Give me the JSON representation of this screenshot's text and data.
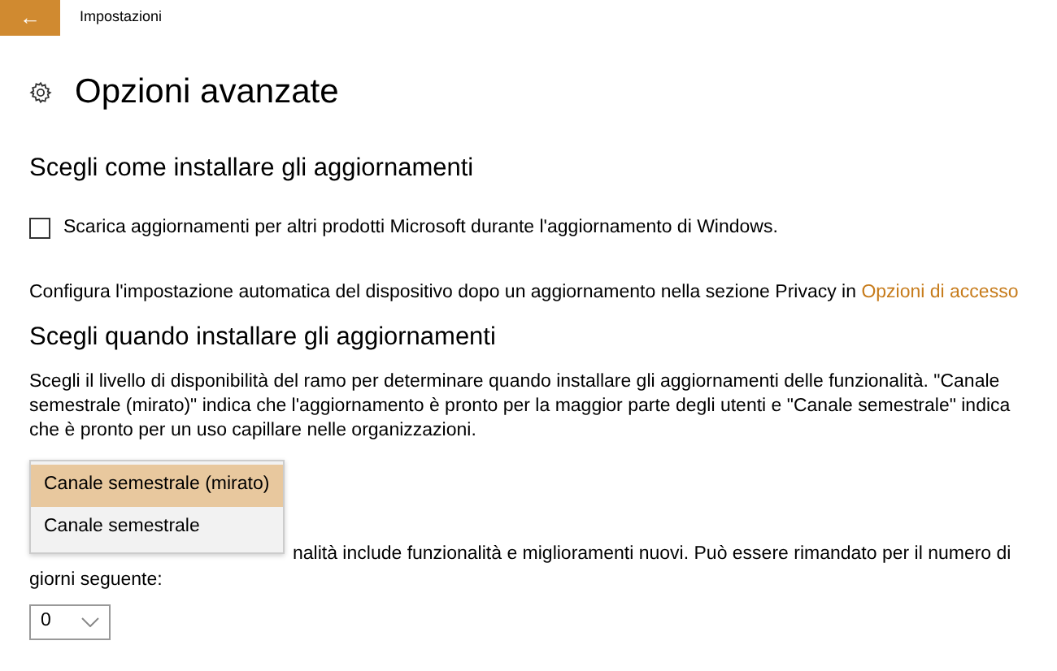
{
  "header": {
    "back_icon": "←",
    "title": "Impostazioni"
  },
  "page_title": "Opzioni avanzate",
  "sections": [
    {
      "heading": "Scegli come installare gli aggiornamenti",
      "checkbox": {
        "label": "Scarica aggiornamenti per altri prodotti Microsoft durante l'aggiornamento di Windows.",
        "checked": false
      },
      "note": "Configura l'impostazione automatica del dispositivo dopo un aggiornamento nella sezione Privacy in",
      "link": "Opzioni di accesso"
    },
    {
      "heading": "Scegli quando installare gli aggiornamenti",
      "description": "Scegli il livello di disponibilità del ramo per determinare quando installare gli aggiornamenti delle funzionalità. \"Canale semestrale (mirato)\" indica che l'aggiornamento è pronto per la maggior parte degli utenti e \"Canale semestrale\" indica che è pronto per un uso capillare nelle organizzazioni.",
      "dropdown": {
        "options": [
          {
            "label": "Canale semestrale (mirato)",
            "selected": true
          },
          {
            "label": "Canale semestrale",
            "selected": false
          }
        ]
      },
      "deferral_text": "nalità include funzionalità e miglioramenti nuovi. Può essere rimandato per il numero di giorni seguente:",
      "days_select": {
        "value": "0"
      }
    }
  ]
}
